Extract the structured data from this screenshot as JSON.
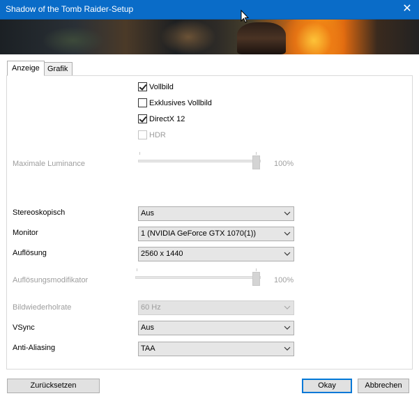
{
  "window": {
    "title": "Shadow of the Tomb Raider-Setup",
    "close_glyph": "✕"
  },
  "tabs": [
    {
      "label": "Anzeige",
      "active": true
    },
    {
      "label": "Grafik",
      "active": false
    }
  ],
  "checkboxes": {
    "vollbild": {
      "label": "Vollbild",
      "checked": true,
      "enabled": true
    },
    "exklusives_vollbild": {
      "label": "Exklusives Vollbild",
      "checked": false,
      "enabled": true
    },
    "directx12": {
      "label": "DirectX 12",
      "checked": true,
      "enabled": true
    },
    "hdr": {
      "label": "HDR",
      "checked": false,
      "enabled": false
    }
  },
  "luminance": {
    "label": "Maximale Luminance",
    "value": "100%",
    "level": 1.0,
    "enabled": false
  },
  "stereoskopisch": {
    "label": "Stereoskopisch",
    "value": "Aus"
  },
  "monitor": {
    "label": "Monitor",
    "value": "1 (NVIDIA GeForce GTX 1070(1))"
  },
  "aufloesung": {
    "label": "Auflösung",
    "value": "2560 x 1440"
  },
  "aufloesungsmodifikator": {
    "label": "Auflösungsmodifikator",
    "value": "100%",
    "level": 1.0,
    "enabled": false
  },
  "bildwiederholrate": {
    "label": "Bildwiederholrate",
    "value": "60 Hz",
    "enabled": false
  },
  "vsync": {
    "label": "VSync",
    "value": "Aus"
  },
  "anti_aliasing": {
    "label": "Anti-Aliasing",
    "value": "TAA"
  },
  "buttons": {
    "reset": "Zurücksetzen",
    "okay": "Okay",
    "cancel": "Abbrechen"
  },
  "colors": {
    "titlebar": "#0a6cc8",
    "accent": "#0078d7",
    "disabled_text": "#9d9d9d"
  }
}
